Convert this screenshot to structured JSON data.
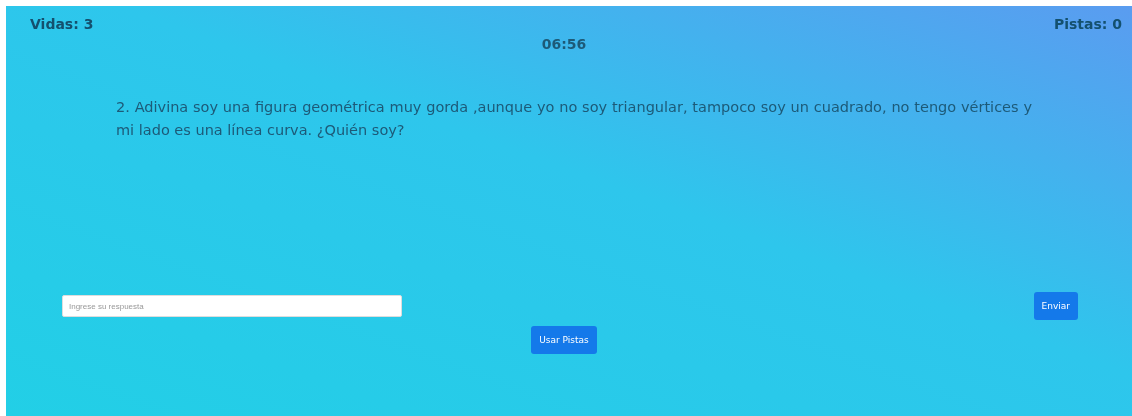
{
  "lives": "Vidas: 3",
  "hints": "Pistas: 0",
  "timer": "06:56",
  "question": "2. Adivina soy una figura geométrica muy gorda ,aunque yo no soy triangular, tampoco soy un cuadrado, no tengo vértices y mi lado es una línea curva. ¿Quién soy?",
  "answer": {
    "placeholder": "Ingrese su respuesta"
  },
  "buttons": {
    "submit": "Enviar",
    "use_hints": "Usar Pistas"
  }
}
